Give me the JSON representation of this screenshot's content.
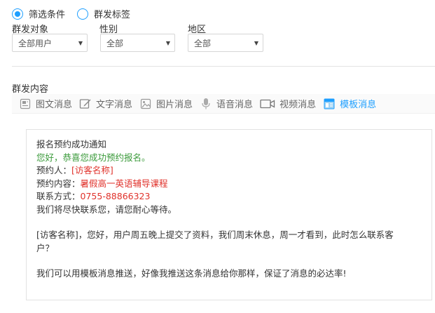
{
  "radio": {
    "filter_label": "筛选条件",
    "tag_label": "群发标签",
    "selected": "filter"
  },
  "filters": {
    "audience": {
      "label": "群发对象",
      "value": "全部用户"
    },
    "gender": {
      "label": "性别",
      "value": "全部"
    },
    "region": {
      "label": "地区",
      "value": "全部"
    }
  },
  "content_section": {
    "label": "群发内容",
    "tools": [
      {
        "label": "图文消息",
        "icon": "news-icon",
        "active": false
      },
      {
        "label": "文字消息",
        "icon": "text-edit-icon",
        "active": false
      },
      {
        "label": "图片消息",
        "icon": "image-icon",
        "active": false
      },
      {
        "label": "语音消息",
        "icon": "microphone-icon",
        "active": false
      },
      {
        "label": "视频消息",
        "icon": "video-icon",
        "active": false
      },
      {
        "label": "模板消息",
        "icon": "template-icon",
        "active": true
      }
    ]
  },
  "message": {
    "title": "报名预约成功通知",
    "greeting": "您好，恭喜您成功预约报名。",
    "booker_label": "预约人：",
    "booker_value": "[访客名称]",
    "content_label": "预约内容：",
    "content_value": "暑假高一英语辅导课程",
    "contact_label": "联系方式：",
    "contact_value": "0755-88866323",
    "closing": "我们将尽快联系您，请您耐心等待。",
    "para2_line1": "[访客名称]，您好，用户周五晚上提交了资料，我们周末休息，周一才看到，此时怎么联系客",
    "para2_line2": "户？",
    "para3": "我们可以用模板消息推送，好像我推送这条消息给你那样，保证了消息的必达率!"
  },
  "colors": {
    "accent": "#1e9fff",
    "green_text": "#3a9a3a",
    "red_text": "#e0322b"
  }
}
